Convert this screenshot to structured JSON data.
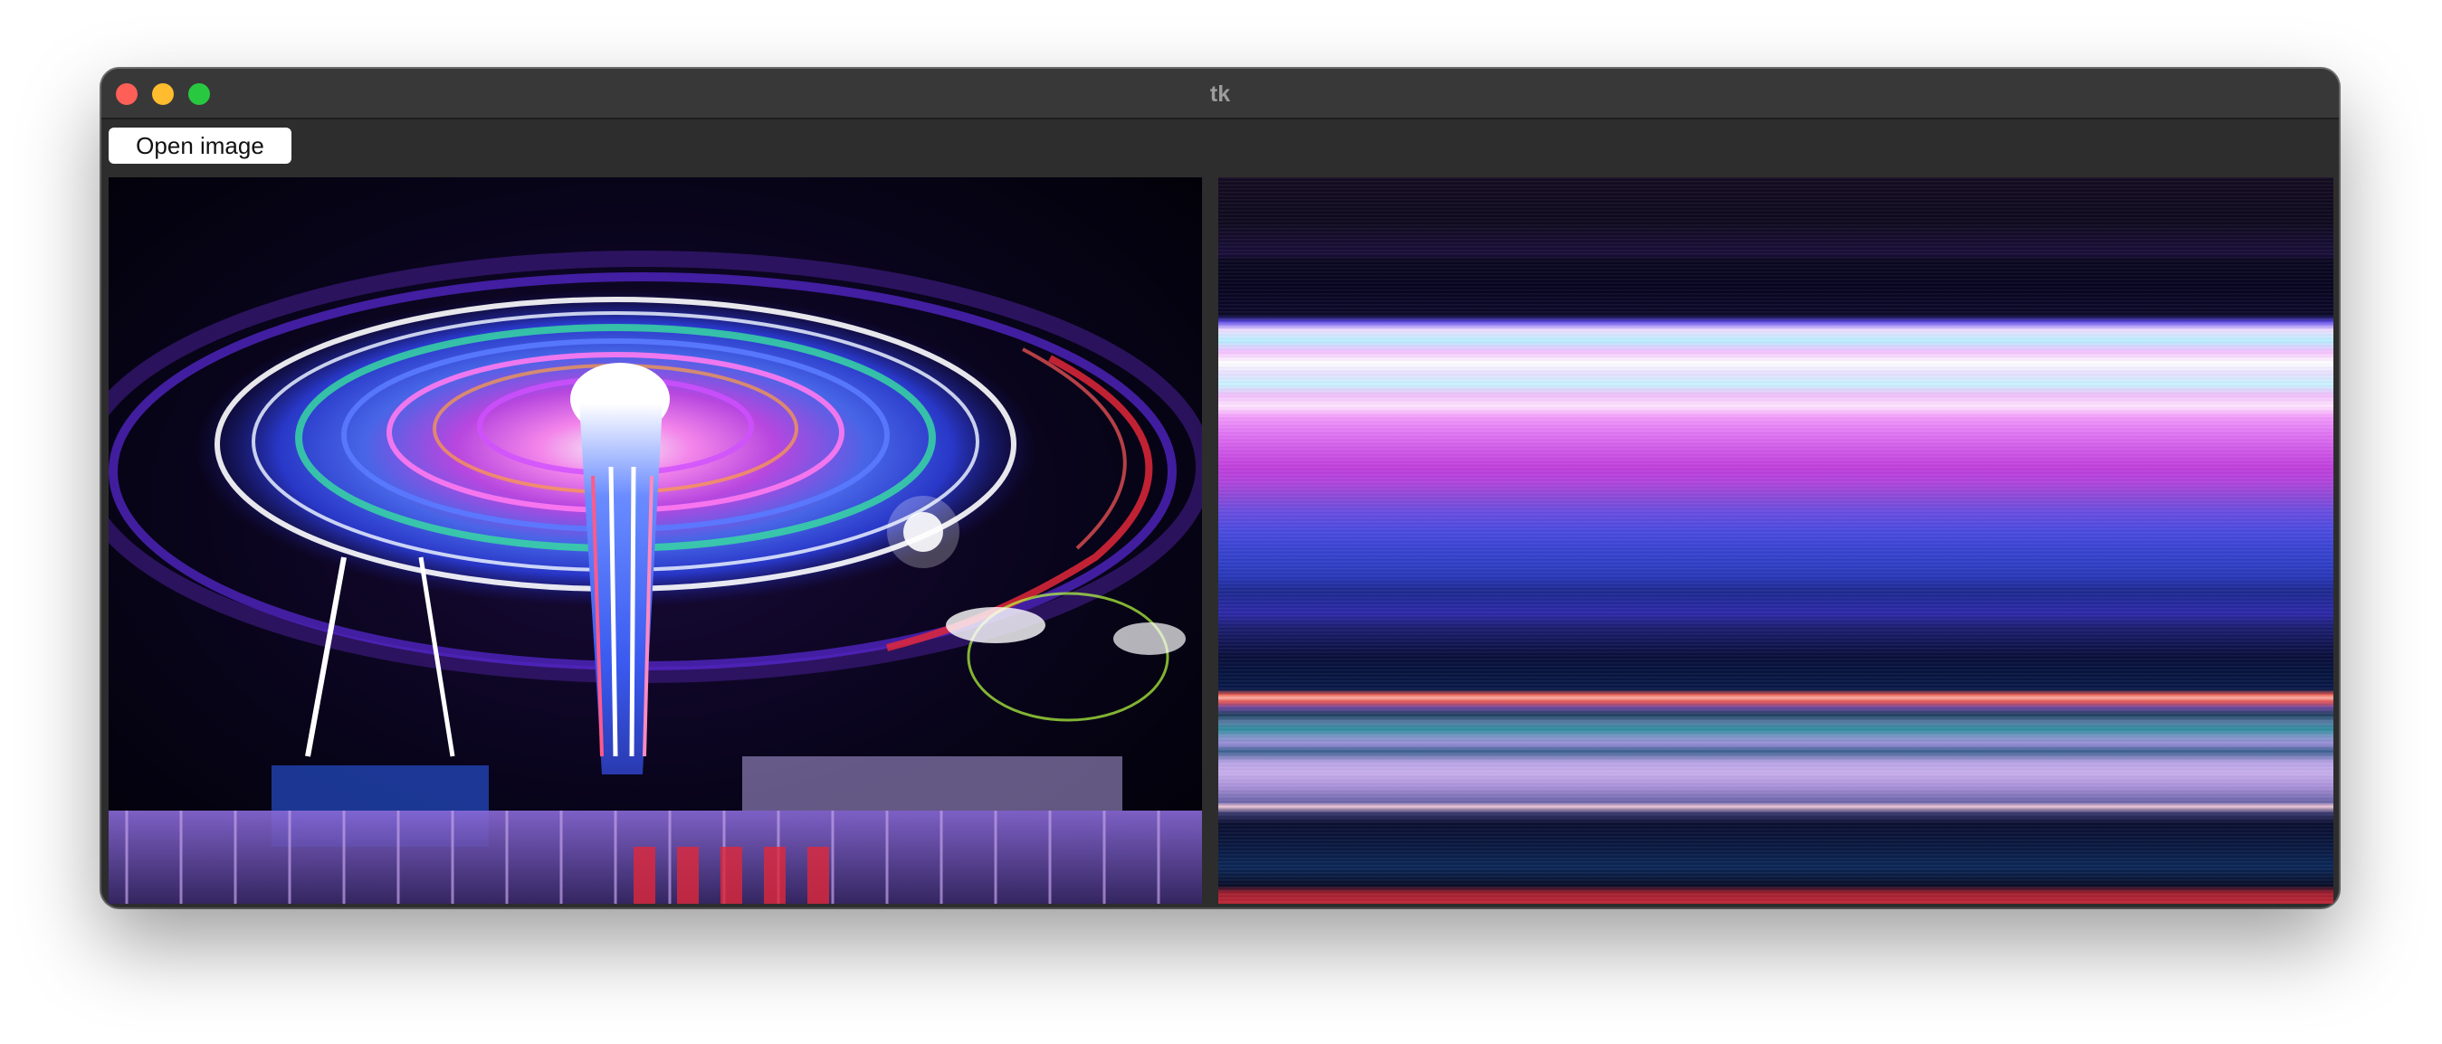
{
  "window": {
    "title": "tk"
  },
  "toolbar": {
    "open_image_label": "Open image"
  },
  "panels": {
    "left": {
      "content": "photo-carnival-swing-ride-night"
    },
    "right": {
      "content": "horizontal-color-stripes"
    }
  },
  "colors": {
    "titlebar": "#383838",
    "window_bg": "#2d2d2d",
    "traffic_close": "#fe5f57",
    "traffic_minimize": "#febc2e",
    "traffic_maximize": "#28c840"
  }
}
